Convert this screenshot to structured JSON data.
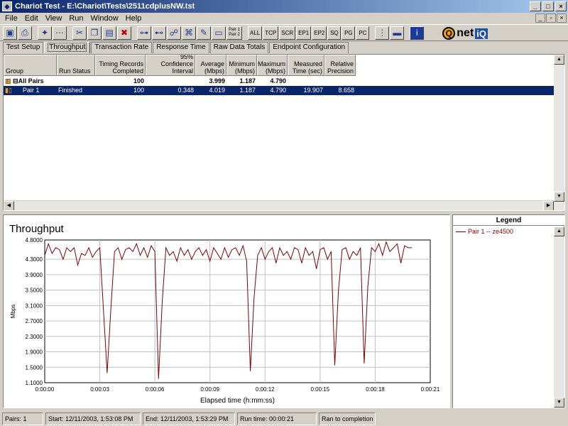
{
  "window": {
    "title": "Chariot Test - E:\\Chariot\\Tests\\2511cdplusNW.tst"
  },
  "menu": [
    "File",
    "Edit",
    "View",
    "Run",
    "Window",
    "Help"
  ],
  "toolbar": {
    "text_buttons": [
      "ALL",
      "TCP",
      "SCR",
      "EP1",
      "EP2",
      "SQ",
      "PG",
      "PC"
    ],
    "pair_button": "Pair 1 Pair 2",
    "logo": {
      "q": "Q",
      "net": "net",
      "iq": "iQ"
    }
  },
  "tabs": [
    "Test Setup",
    "Throughput",
    "Transaction Rate",
    "Response Time",
    "Raw Data Totals",
    "Endpoint Configuration"
  ],
  "grid": {
    "columns": [
      "Group",
      "Run Status",
      "Timing Records Completed",
      "95% Confidence Interval",
      "Average (Mbps)",
      "Minimum (Mbps)",
      "Maximum (Mbps)",
      "Measured Time (sec)",
      "Relative Precision"
    ],
    "all_pairs": {
      "group": "All Pairs",
      "status": "",
      "records": "100",
      "ci": "",
      "avg": "3.999",
      "min": "1.187",
      "max": "4.790",
      "time": "",
      "precision": ""
    },
    "pair1": {
      "group": "Pair 1",
      "status": "Finished",
      "records": "100",
      "ci": "0.348",
      "avg": "4.019",
      "min": "1.187",
      "max": "4.790",
      "time": "19.907",
      "precision": "8.658"
    }
  },
  "chart_data": {
    "type": "line",
    "title": "Throughput",
    "xlabel": "Elapsed time (h:mm:ss)",
    "ylabel": "Mbps",
    "xlim": [
      0,
      21
    ],
    "ylim": [
      1.1,
      4.8
    ],
    "yticks": [
      "4.8000",
      "4.3000",
      "3.9000",
      "3.5000",
      "3.1000",
      "2.7000",
      "2.3000",
      "1.9000",
      "1.5000",
      "1.1000"
    ],
    "xticks": [
      "0:00:00",
      "0:00:03",
      "0:00:06",
      "0:00:09",
      "0:00:12",
      "0:00:15",
      "0:00:18",
      "0:00:21"
    ],
    "series": [
      {
        "name": "Pair 1 -- ze4500",
        "color": "#800000",
        "x": [
          0.0,
          0.2,
          0.4,
          0.6,
          0.8,
          1.0,
          1.2,
          1.4,
          1.6,
          1.8,
          2.0,
          2.2,
          2.4,
          2.6,
          2.8,
          3.0,
          3.4,
          3.6,
          3.8,
          4.0,
          4.2,
          4.4,
          4.6,
          4.8,
          5.0,
          5.2,
          5.4,
          5.6,
          5.8,
          6.0,
          6.2,
          6.4,
          6.6,
          6.8,
          7.0,
          7.2,
          7.4,
          7.6,
          7.8,
          8.0,
          8.2,
          8.4,
          8.6,
          8.8,
          9.0,
          9.2,
          9.4,
          9.6,
          9.8,
          10.0,
          10.2,
          10.4,
          10.6,
          10.8,
          11.0,
          11.2,
          11.4,
          11.6,
          11.8,
          12.0,
          12.2,
          12.4,
          12.6,
          12.8,
          13.0,
          13.2,
          13.4,
          13.6,
          13.8,
          14.0,
          14.2,
          14.4,
          14.6,
          14.8,
          15.0,
          15.2,
          15.4,
          15.6,
          15.8,
          16.0,
          16.2,
          16.4,
          16.6,
          16.8,
          17.0,
          17.2,
          17.4,
          17.6,
          17.8,
          18.0,
          18.2,
          18.4,
          18.6,
          18.8,
          19.0,
          19.2,
          19.4,
          19.6,
          19.8,
          20.0
        ],
        "values": [
          4.4,
          4.7,
          4.45,
          4.6,
          4.55,
          4.3,
          4.6,
          4.5,
          4.6,
          4.15,
          4.45,
          4.4,
          4.6,
          4.35,
          4.5,
          4.6,
          1.35,
          3.0,
          4.5,
          4.6,
          4.3,
          4.55,
          4.6,
          4.5,
          4.7,
          4.4,
          4.6,
          4.35,
          4.65,
          4.5,
          1.2,
          3.2,
          4.6,
          4.4,
          4.5,
          4.25,
          4.6,
          4.4,
          4.55,
          4.3,
          4.5,
          4.6,
          4.4,
          4.55,
          4.25,
          4.6,
          4.45,
          4.3,
          4.6,
          4.35,
          4.55,
          4.6,
          4.4,
          4.65,
          4.25,
          1.4,
          3.3,
          4.4,
          4.6,
          4.3,
          4.5,
          4.6,
          4.2,
          4.6,
          4.4,
          4.5,
          4.3,
          4.6,
          4.55,
          4.2,
          4.6,
          4.4,
          4.5,
          4.05,
          4.55,
          4.6,
          4.3,
          4.5,
          1.55,
          3.5,
          4.55,
          4.6,
          4.3,
          4.5,
          4.4,
          4.6,
          1.6,
          3.6,
          4.6,
          4.5,
          4.7,
          4.4,
          4.75,
          4.5,
          4.6,
          4.7,
          4.2,
          4.65,
          4.6,
          4.6
        ]
      }
    ]
  },
  "legend": {
    "title": "Legend",
    "item": "Pair 1 -- ze4500"
  },
  "status": {
    "pairs": "Pairs: 1",
    "start": "Start: 12/11/2003, 1:53:08 PM",
    "end": "End: 12/11/2003, 1:53:29 PM",
    "runtime": "Run time: 00:00:21",
    "result": "Ran to completion"
  }
}
